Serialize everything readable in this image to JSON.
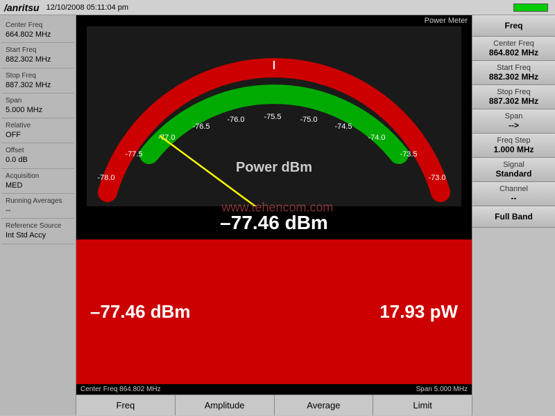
{
  "topBar": {
    "logo": "/anritsu",
    "datetime": "12/10/2008  05:11:04 pm"
  },
  "leftSidebar": {
    "params": [
      {
        "label": "Center Freq",
        "value": "664.802 MHz"
      },
      {
        "label": "Start Freq",
        "value": "882.302 MHz"
      },
      {
        "label": "Stop Freq",
        "value": "887.302 MHz"
      },
      {
        "label": "Span",
        "value": "5.000 MHz"
      },
      {
        "label": "Relative",
        "value": "OFF"
      },
      {
        "label": "Offset",
        "value": "0.0 dB"
      },
      {
        "label": "Acquisition",
        "value": "MED"
      },
      {
        "label": "Running Averages",
        "value": "--"
      },
      {
        "label": "Reference Source",
        "value": "Int Std Accy"
      }
    ]
  },
  "gauge": {
    "powerMeterLabel": "Power Meter",
    "powerLabel": "Power dBm",
    "reading": "–77.46 dBm",
    "scaleLabels": [
      "-78.0",
      "-77.5",
      "-77.0",
      "-76.5",
      "-76.0",
      "-75.5",
      "-75.0",
      "-74.5",
      "-74.0",
      "-73.5",
      "-73.0"
    ]
  },
  "bottomDisplay": {
    "dbmValue": "–77.46 dBm",
    "pwValue": "17.93 pW",
    "watermark": "www.tehencom.com"
  },
  "statusBar": {
    "left": "Center Freq 864.802 MHz",
    "right": "Span 5.000 MHz"
  },
  "bottomTabs": {
    "tabs": [
      "Freq",
      "Amplitude",
      "Average",
      "Limit"
    ]
  },
  "rightSidebar": {
    "buttons": [
      {
        "label": "Freq",
        "value": ""
      },
      {
        "label": "Center Freq",
        "value": "864.802 MHz"
      },
      {
        "label": "Start Freq",
        "value": "882.302 MHz"
      },
      {
        "label": "Stop Freq",
        "value": "887.302 MHz"
      },
      {
        "label": "Span",
        "value": "-->"
      },
      {
        "label": "Freq Step",
        "value": "1.000 MHz"
      },
      {
        "label": "Signal",
        "value": "Standard"
      },
      {
        "label": "Channel",
        "value": "--"
      },
      {
        "label": "Full Band",
        "value": ""
      }
    ]
  }
}
